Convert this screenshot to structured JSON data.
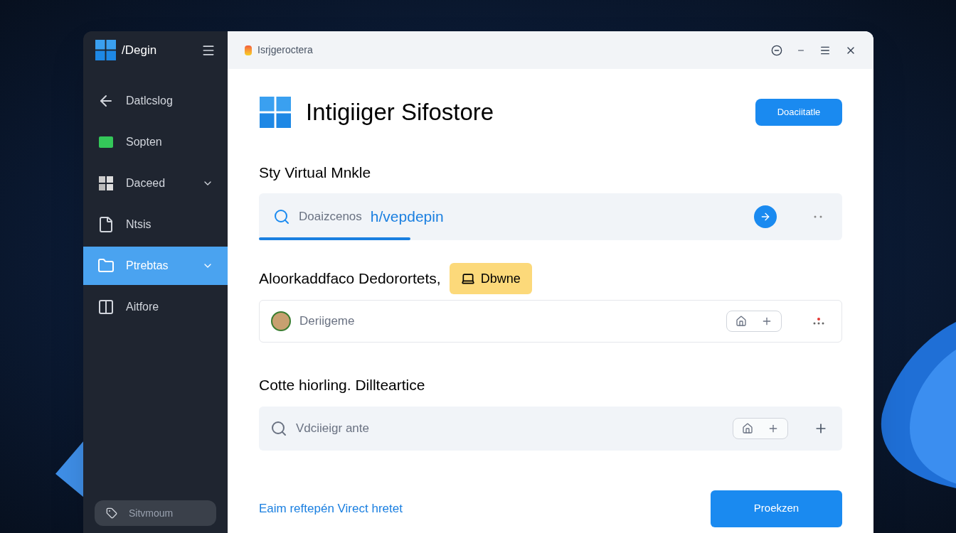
{
  "sidebar": {
    "title": "/Degin",
    "items": [
      {
        "label": "Datlcslog",
        "kind": "back",
        "expandable": false,
        "selected": false
      },
      {
        "label": "Sopten",
        "kind": "app",
        "expandable": false,
        "selected": false
      },
      {
        "label": "Daceed",
        "kind": "grid",
        "expandable": true,
        "selected": false
      },
      {
        "label": "Ntsis",
        "kind": "page",
        "expandable": false,
        "selected": false
      },
      {
        "label": "Ptrebtas",
        "kind": "folder",
        "expandable": true,
        "selected": true
      },
      {
        "label": "Aitfore",
        "kind": "columns",
        "expandable": false,
        "selected": false
      }
    ],
    "footer_button": "Sitvmoum"
  },
  "window": {
    "title": "Isrjgeroctera"
  },
  "header": {
    "title": "Intigiiger Sifostore",
    "button": "Doaciitatle"
  },
  "search_section": {
    "heading": "Sty Virtual Mnkle",
    "label": "Doaizcenos",
    "value": "h/vepdepin",
    "level": 0.26
  },
  "devices_section": {
    "heading": "Aloorkaddfaco Dedorortets,",
    "badge": "Dbwne",
    "row": {
      "label": "Deriigeme"
    }
  },
  "filter_section": {
    "heading": "Cotte hiorling. Dillteartice",
    "placeholder": "Vdciieigr ante"
  },
  "footer": {
    "link": "Eaim reftepén Virect hretet",
    "button": "Proekzen"
  }
}
